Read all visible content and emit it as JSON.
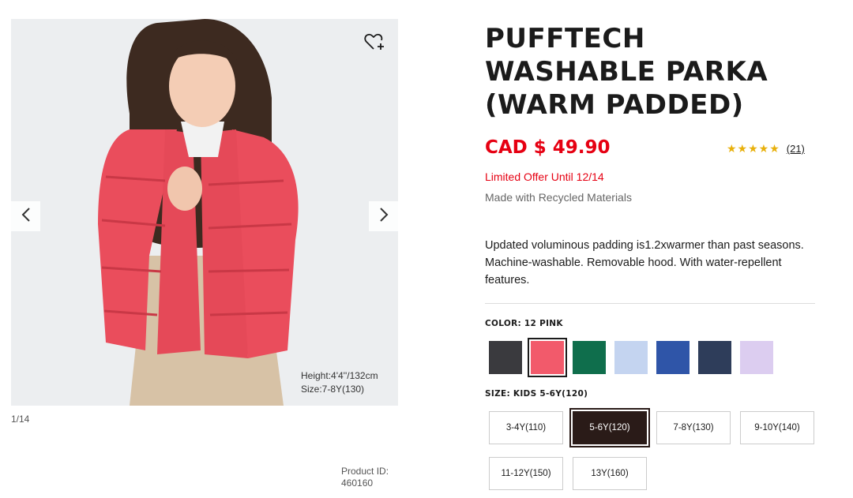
{
  "gallery": {
    "counter": "1/14",
    "overlay_height": "Height:4'4''/132cm",
    "overlay_size": "Size:7-8Y(130)",
    "product_id_label": "Product ID:",
    "product_id_value": "460160",
    "icons": {
      "wishlist": "heart-plus-icon",
      "prev": "chevron-left-icon",
      "next": "chevron-right-icon"
    }
  },
  "product": {
    "title_line1": "PUFFTECH",
    "title_line2": "WASHABLE PARKA",
    "title_line3": "(WARM PADDED)",
    "price": "CAD $ 49.90",
    "rating_stars": "★★★★★",
    "rating_value": 4.5,
    "review_count": "(21)",
    "offer": "Limited Offer Until 12/14",
    "material": "Made with Recycled Materials",
    "description": "Updated voluminous padding is1.2xwarmer than past seasons. Machine-washable. Removable hood. With water-repellent features."
  },
  "color": {
    "label": "COLOR: 12 PINK",
    "swatches": [
      {
        "name": "dark-gray",
        "hex": "#3a3a3e"
      },
      {
        "name": "pink",
        "hex": "#f25a6b",
        "selected": true
      },
      {
        "name": "green",
        "hex": "#0f6e4c"
      },
      {
        "name": "light-blue",
        "hex": "#c4d4f0"
      },
      {
        "name": "blue",
        "hex": "#2f55a8"
      },
      {
        "name": "navy",
        "hex": "#2e3d5a"
      },
      {
        "name": "lavender",
        "hex": "#dccdf0"
      }
    ]
  },
  "size": {
    "label": "SIZE: KIDS 5-6Y(120)",
    "options": [
      "3-4Y(110)",
      "5-6Y(120)",
      "7-8Y(130)",
      "9-10Y(140)",
      "11-12Y(150)",
      "13Y(160)"
    ],
    "selected_index": 1
  },
  "colors": {
    "accent": "#e60012",
    "star": "#e8b00b",
    "text": "#1b1b1b"
  }
}
